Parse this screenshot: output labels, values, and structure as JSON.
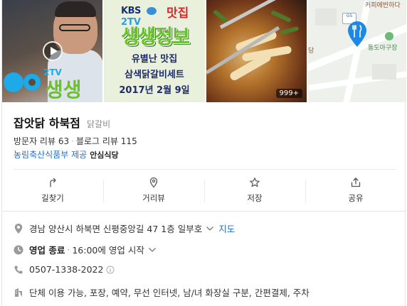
{
  "photos": [
    {
      "label": "video-thumbnail",
      "overlay_text": "2TV 생생"
    },
    {
      "label": "poster",
      "kbs": "KBS",
      "channel": "2TV",
      "matjip": "맛집",
      "show": "생생정보",
      "line1": "유별난 맛집",
      "line2": "삼색닭갈비세트",
      "line3": "2017년 2월 9일"
    },
    {
      "label": "food-photo",
      "count_badge": "999+"
    },
    {
      "label": "map",
      "map_labels": [
        "커피에반하다",
        "당",
        "통도아구장"
      ],
      "gs": "GS"
    }
  ],
  "place": {
    "name": "잡앗닭 하북점",
    "category": "닭갈비",
    "visitor_reviews_label": "방문자 리뷰",
    "visitor_reviews_count": "63",
    "blog_reviews_label": "블로그 리뷰",
    "blog_reviews_count": "115",
    "provider_text": "농림축산식품부 제공",
    "provider_badge": "안심식당"
  },
  "actions": [
    {
      "label": "길찾기",
      "icon": "directions-icon"
    },
    {
      "label": "거리뷰",
      "icon": "streetview-icon"
    },
    {
      "label": "저장",
      "icon": "star-icon"
    },
    {
      "label": "공유",
      "icon": "share-icon"
    }
  ],
  "details": {
    "address": "경남 양산시 하북면 신평중앙길 47 1층 일부호",
    "map_link": "지도",
    "hours_status": "영업 종료",
    "hours_detail": "16:00에 영업 시작",
    "phone": "0507-1338-2022",
    "amenities": "단체 이용 가능, 포장, 예약, 무선 인터넷, 남/녀 화장실 구분, 간편결제, 주차"
  },
  "colors": {
    "link": "#1d6fd6",
    "pin": "#1e88e5"
  }
}
